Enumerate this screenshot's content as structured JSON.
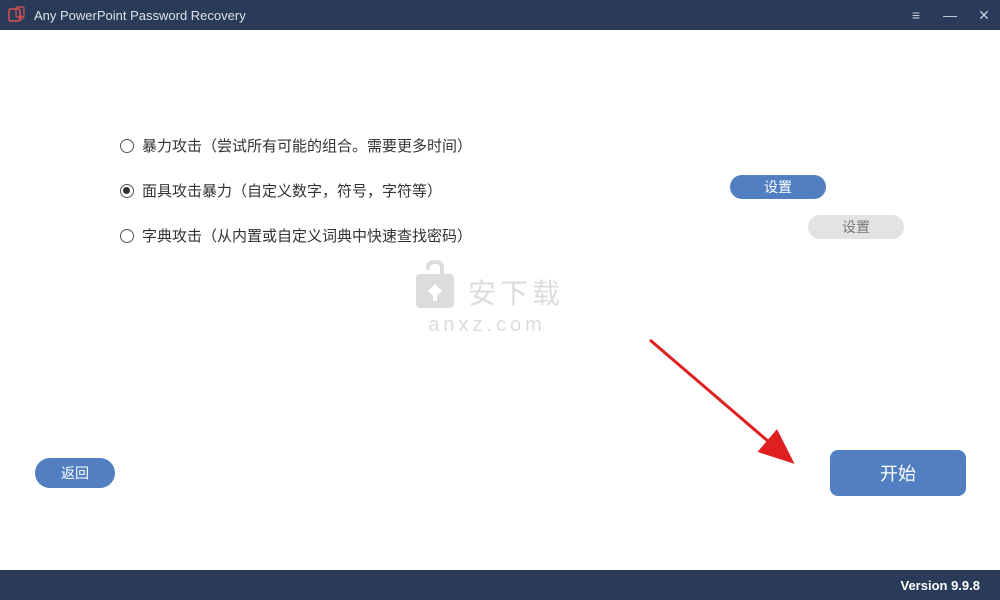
{
  "titlebar": {
    "title": "Any PowerPoint Password Recovery"
  },
  "options": {
    "brute_force": "暴力攻击（尝试所有可能的组合。需要更多时间）",
    "mask_attack": "面具攻击暴力（自定义数字，符号，字符等）",
    "dictionary": "字典攻击（从内置或自定义词典中快速查找密码）"
  },
  "buttons": {
    "settings1": "设置",
    "settings2": "设置",
    "back": "返回",
    "start": "开始"
  },
  "watermark": {
    "line1": "安下载",
    "line2": "anxz.com"
  },
  "footer": {
    "version": "Version 9.9.8"
  }
}
